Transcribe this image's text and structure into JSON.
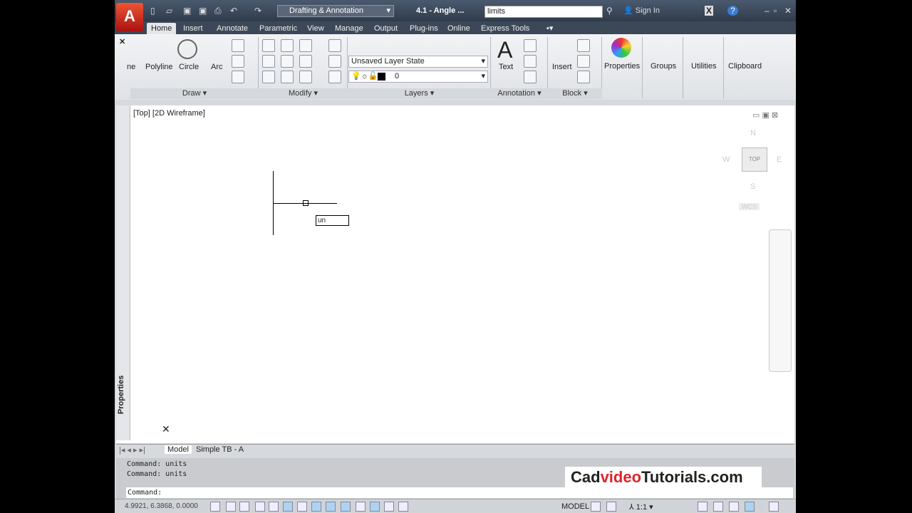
{
  "title": {
    "workspace": "Drafting & Annotation",
    "document": "4.1 - Angle ...",
    "search_value": "limits",
    "sign_in": "Sign In",
    "help": "?"
  },
  "tabs": [
    "Home",
    "Insert",
    "Annotate",
    "Parametric",
    "View",
    "Manage",
    "Output",
    "Plug-ins",
    "Online",
    "Express Tools"
  ],
  "ribbon": {
    "draw": {
      "title": "Draw",
      "tools": [
        "ne",
        "Polyline",
        "Circle",
        "Arc"
      ]
    },
    "modify": {
      "title": "Modify"
    },
    "layers": {
      "title": "Layers",
      "layer_state": "Unsaved Layer State",
      "current_layer": "0"
    },
    "annotation": {
      "title": "Annotation",
      "text": "Text"
    },
    "block": {
      "title": "Block",
      "insert": "Insert"
    },
    "big": [
      "Properties",
      "Groups",
      "Utilities",
      "Clipboard"
    ],
    "palette_title": "Properties"
  },
  "viewport": {
    "label": "[Top] [2D Wireframe]",
    "dynamic_input": "un",
    "viewcube": {
      "top": "TOP",
      "n": "N",
      "s": "S",
      "e": "E",
      "w": "W",
      "wcs": "WCS"
    }
  },
  "layout_tabs": [
    "Model",
    "Simple TB - A"
  ],
  "command": {
    "history": [
      "Command: units",
      "Command: units"
    ],
    "prompt": "Command:"
  },
  "watermark": {
    "part1": "Cad",
    "part2": "video",
    "part3": "Tutorials.com",
    "accent": "#e0242b"
  },
  "status": {
    "coords": "4.9921, 6.3868, 0.0000",
    "model": "MODEL",
    "scale": "1:1"
  }
}
